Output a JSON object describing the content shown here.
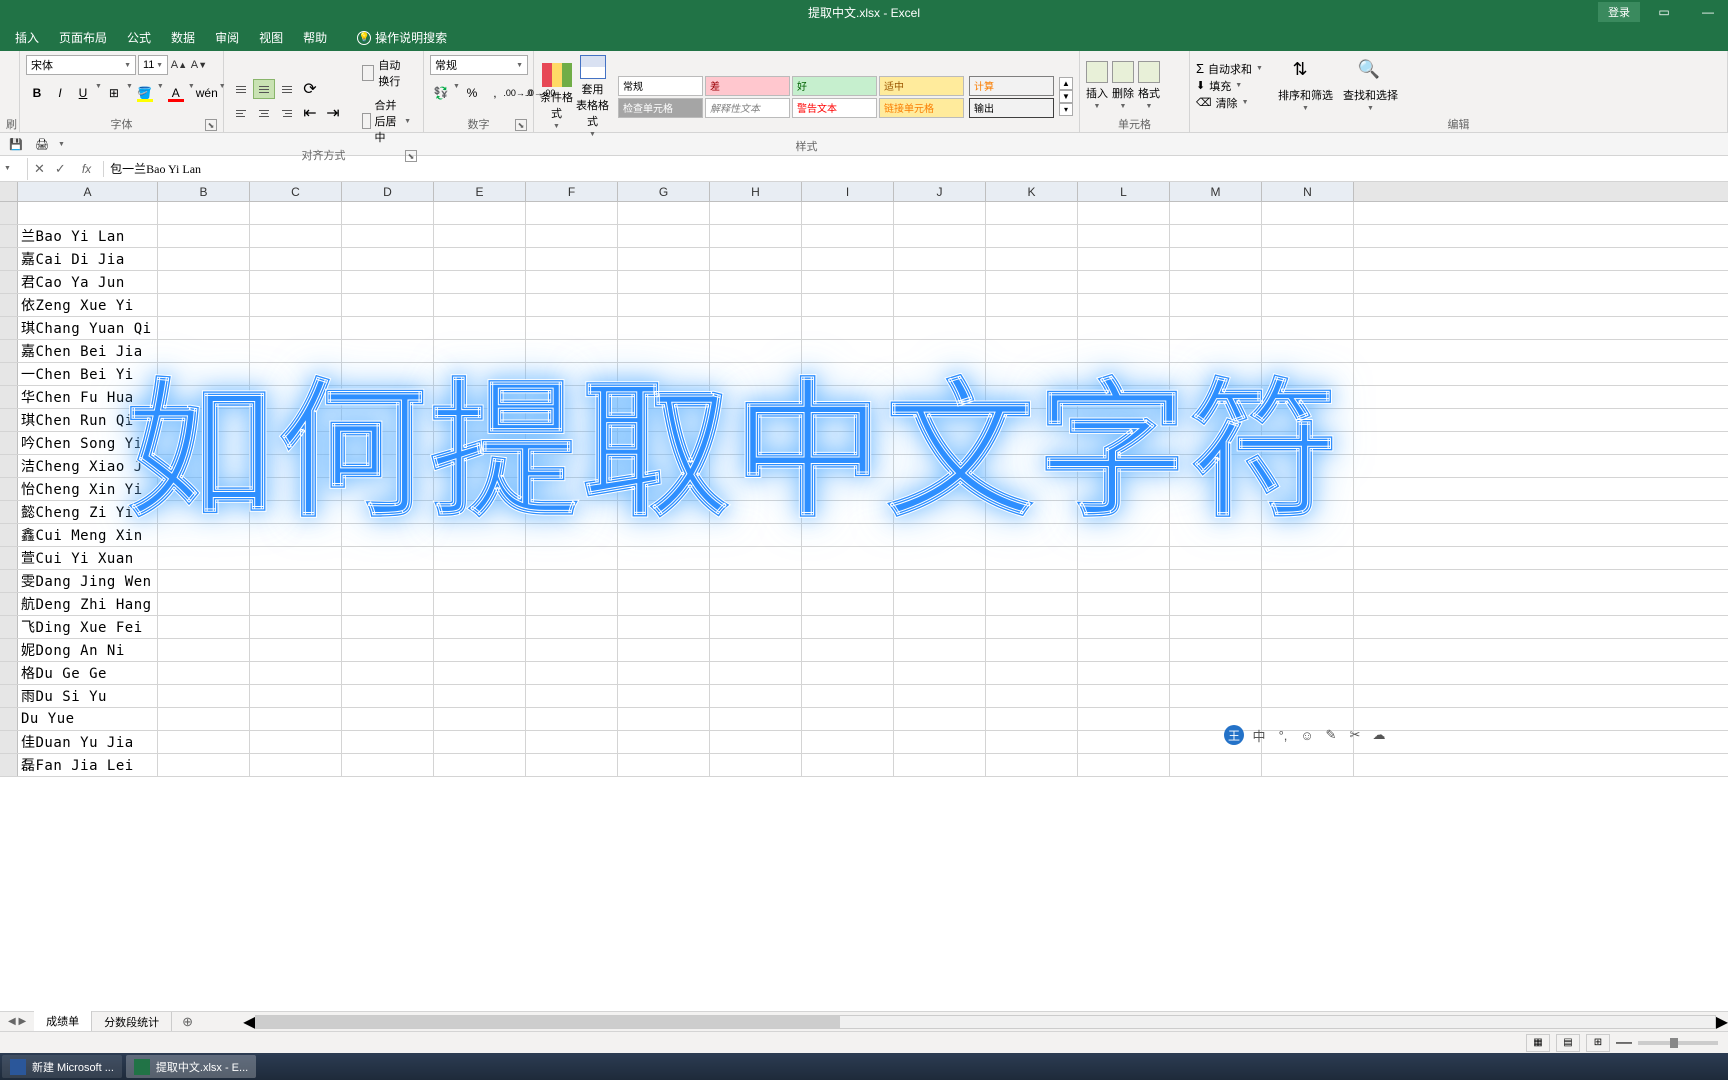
{
  "app": {
    "title": "提取中文.xlsx - Excel",
    "login": "登录"
  },
  "ribbon": {
    "tabs": [
      "插入",
      "页面布局",
      "公式",
      "数据",
      "审阅",
      "视图",
      "帮助"
    ],
    "tell_me": "操作说明搜索",
    "clipboard": {
      "label": "刷"
    },
    "font": {
      "name": "宋体",
      "size": "11",
      "label": "字体",
      "bold": "B",
      "italic": "I",
      "underline": "U"
    },
    "align": {
      "label": "对齐方式",
      "wrap": "自动换行",
      "merge": "合并后居中"
    },
    "number": {
      "format": "常规",
      "label": "数字"
    },
    "styles": {
      "cond_fmt": "条件格式",
      "fmt_table": "套用\n表格格式",
      "label": "样式",
      "items": {
        "normal": "常规",
        "bad": "差",
        "good": "好",
        "neutral": "适中",
        "calc": "计算",
        "check": "检查单元格",
        "explain": "解释性文本",
        "warn": "警告文本",
        "link": "链接单元格",
        "output": "输出"
      }
    },
    "cells": {
      "insert": "插入",
      "delete": "删除",
      "format": "格式",
      "label": "单元格"
    },
    "editing": {
      "autosum": "自动求和",
      "fill": "填充",
      "clear": "清除",
      "sort": "排序和筛选",
      "find": "查找和选择",
      "label": "编辑"
    }
  },
  "formula_bar": {
    "content": "包一兰Bao Yi Lan"
  },
  "columns": [
    "A",
    "B",
    "C",
    "D",
    "E",
    "F",
    "G",
    "H",
    "I",
    "J",
    "K",
    "L",
    "M",
    "N"
  ],
  "rows": [
    "",
    "兰Bao Yi Lan",
    "嘉Cai Di Jia",
    "君Cao Ya Jun",
    "依Zeng Xue Yi",
    "琪Chang Yuan Qi",
    "嘉Chen Bei Jia",
    "一Chen Bei Yi",
    "华Chen Fu Hua",
    "琪Chen Run Qi",
    "吟Chen Song Yin",
    "洁Cheng Xiao J",
    "怡Cheng Xin Yi",
    "懿Cheng Zi Yi",
    "鑫Cui Meng Xin",
    "萱Cui Yi Xuan",
    "雯Dang Jing Wen",
    "航Deng Zhi Hang",
    "飞Ding Xue Fei",
    "妮Dong An Ni",
    "格Du Ge Ge",
    "雨Du Si Yu",
    "Du Yue",
    "佳Duan Yu Jia",
    "磊Fan Jia Lei"
  ],
  "overlay": "如何提取中文字符",
  "sheets": {
    "tab1": "成绩单",
    "tab2": "分数段统计",
    "add": "⊕"
  },
  "taskbar": {
    "item1": "新建 Microsoft ...",
    "item2": "提取中文.xlsx - E..."
  },
  "ime": {
    "badge": "王",
    "lang": "中"
  }
}
